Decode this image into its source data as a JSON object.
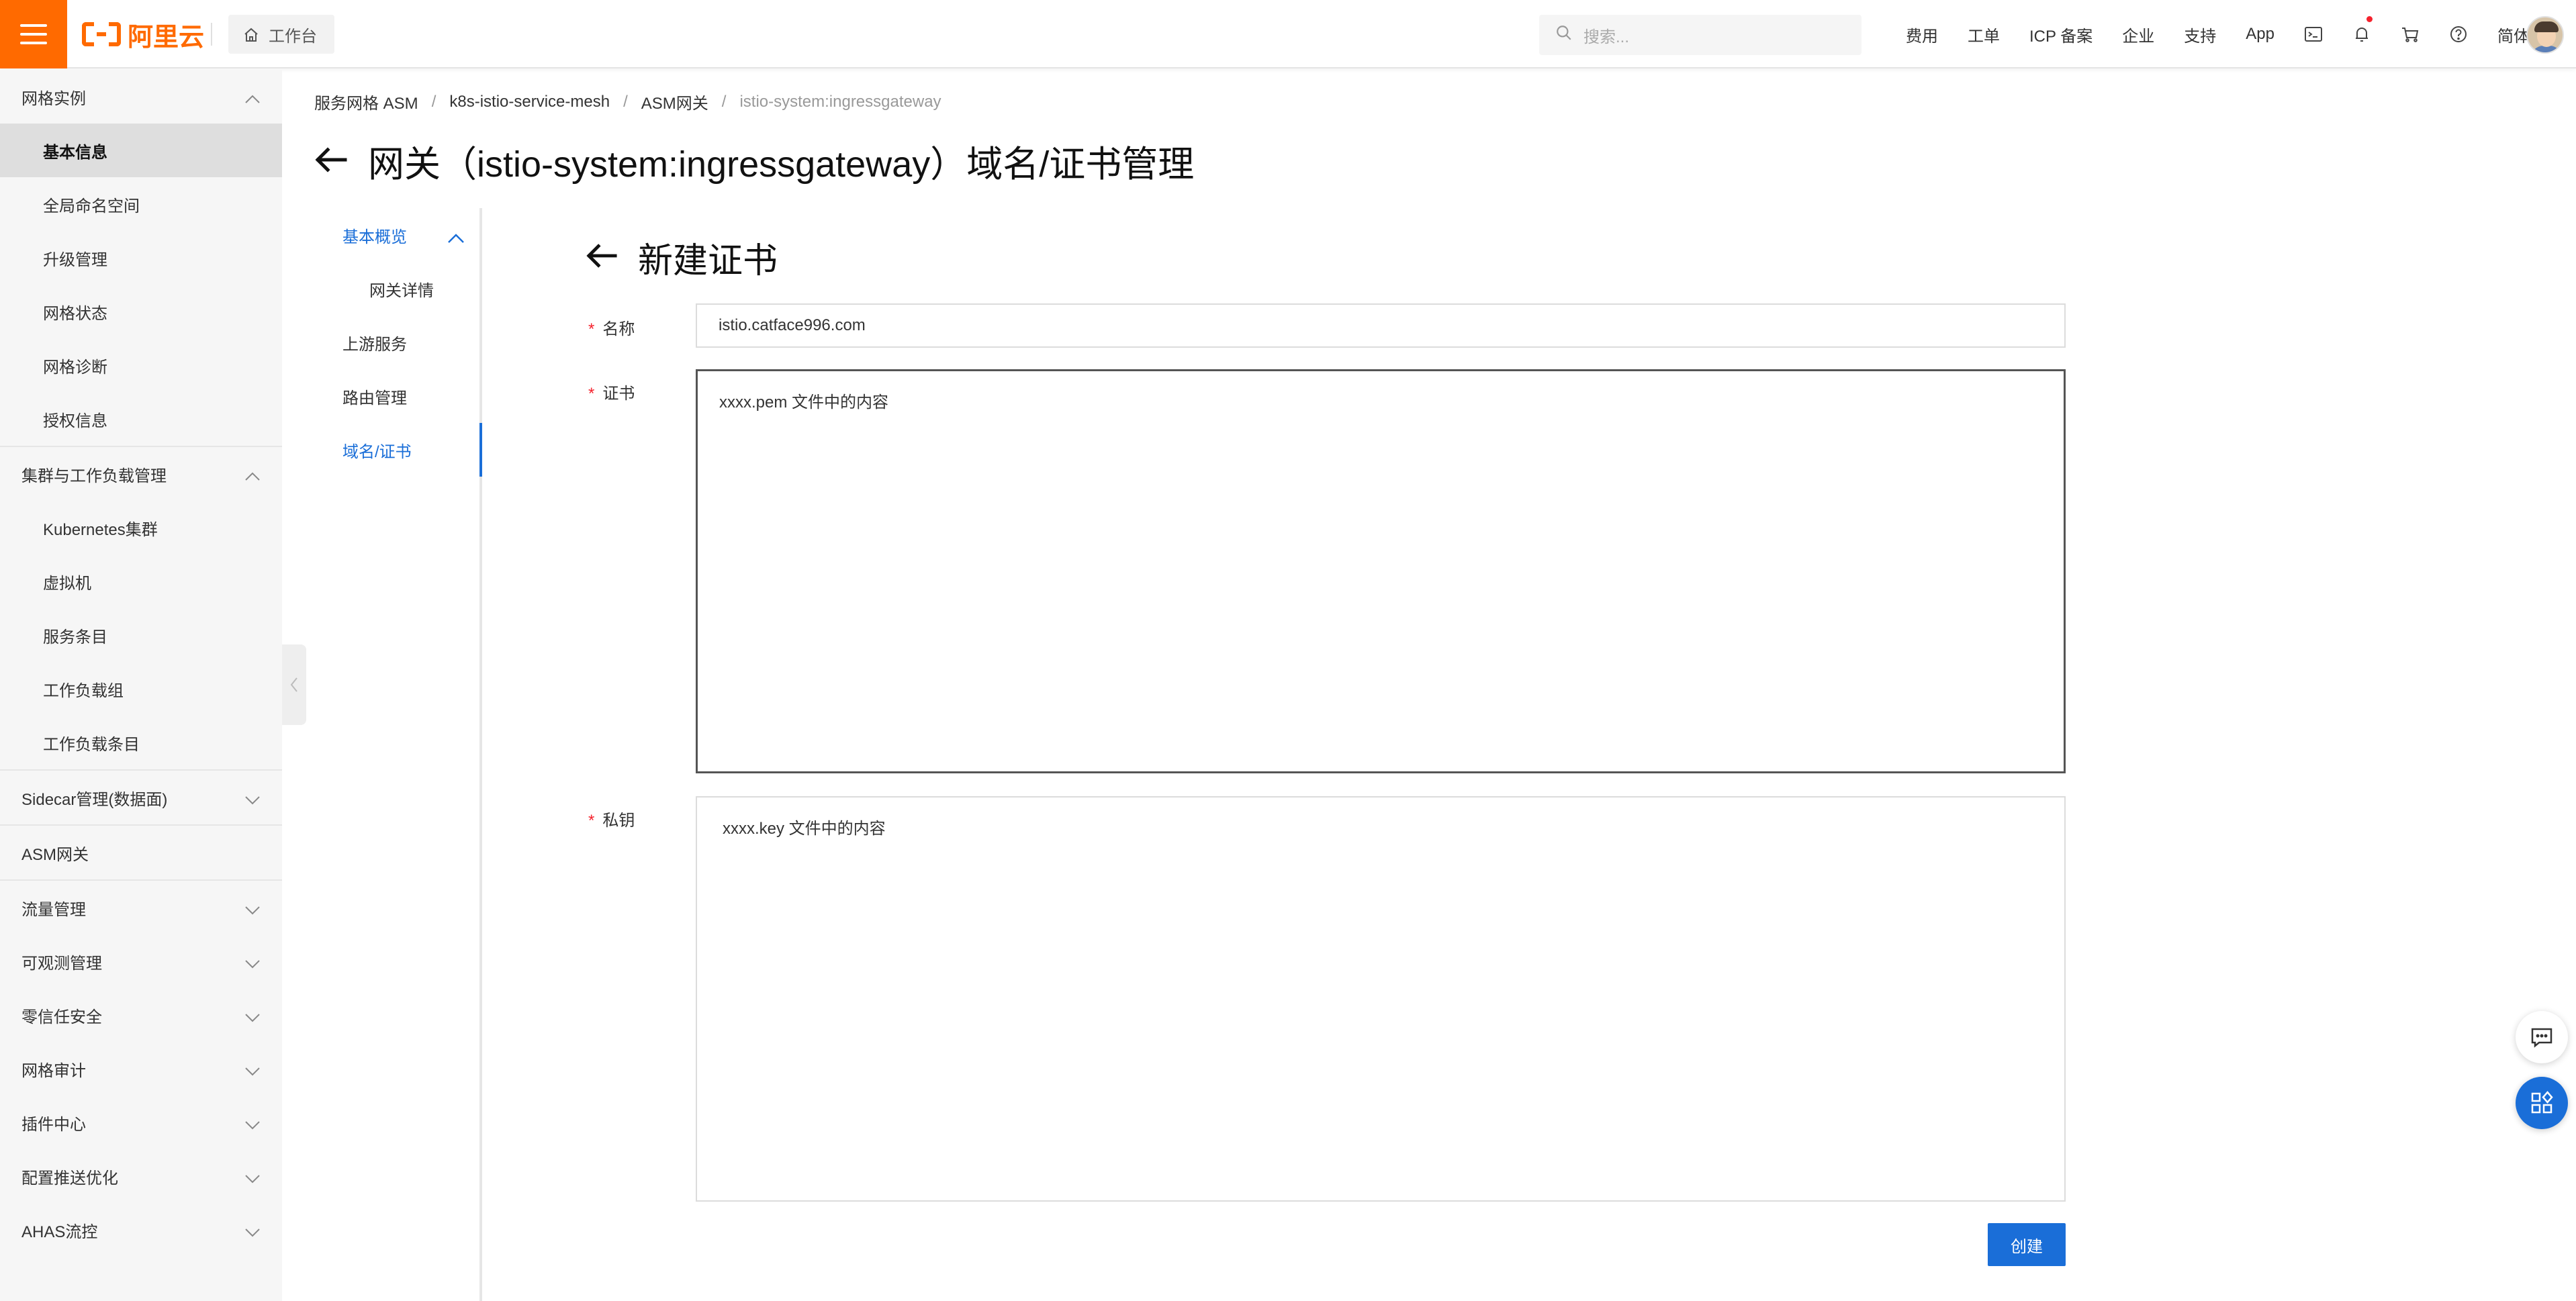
{
  "topbar": {
    "brand": "阿里云",
    "workbench_label": "工作台",
    "search_placeholder": "搜索...",
    "links": [
      "费用",
      "工单",
      "ICP 备案",
      "企业",
      "支持",
      "App"
    ],
    "language": "简体",
    "notification_dot_color": "#f5222d",
    "accent_color": "#ff6a00"
  },
  "sidebar": {
    "groups": [
      {
        "label": "网格实例",
        "expanded": true,
        "items": [
          "基本信息",
          "全局命名空间",
          "升级管理",
          "网格状态",
          "网格诊断",
          "授权信息"
        ],
        "active_item": "基本信息"
      },
      {
        "label": "集群与工作负载管理",
        "expanded": true,
        "items": [
          "Kubernetes集群",
          "虚拟机",
          "服务条目",
          "工作负载组",
          "工作负载条目"
        ]
      },
      {
        "label": "Sidecar管理(数据面)",
        "expanded": false
      },
      {
        "label": "ASM网关",
        "expanded": false
      },
      {
        "label": "流量管理",
        "expanded": false
      },
      {
        "label": "可观测管理",
        "expanded": false
      },
      {
        "label": "零信任安全",
        "expanded": false
      },
      {
        "label": "网格审计",
        "expanded": false
      },
      {
        "label": "插件中心",
        "expanded": false
      },
      {
        "label": "配置推送优化",
        "expanded": false
      },
      {
        "label": "AHAS流控",
        "expanded": false
      }
    ]
  },
  "breadcrumb": [
    "服务网格 ASM",
    "k8s-istio-service-mesh",
    "ASM网关",
    "istio-system:ingressgateway"
  ],
  "page_title": "网关（istio-system:ingressgateway）域名/证书管理",
  "subnav": {
    "overview": "基本概览",
    "gateway_detail": "网关详情",
    "upstream": "上游服务",
    "routing": "路由管理",
    "domain_cert": "域名/证书"
  },
  "form": {
    "title": "新建证书",
    "required_mark": "*",
    "name_label": "名称",
    "name_value": "istio.catface996.com",
    "cert_label": "证书",
    "cert_value": "xxxx.pem 文件中的内容",
    "key_label": "私钥",
    "key_value": "xxxx.key 文件中的内容",
    "submit_label": "创建",
    "primary_color": "#1a6ed8"
  }
}
